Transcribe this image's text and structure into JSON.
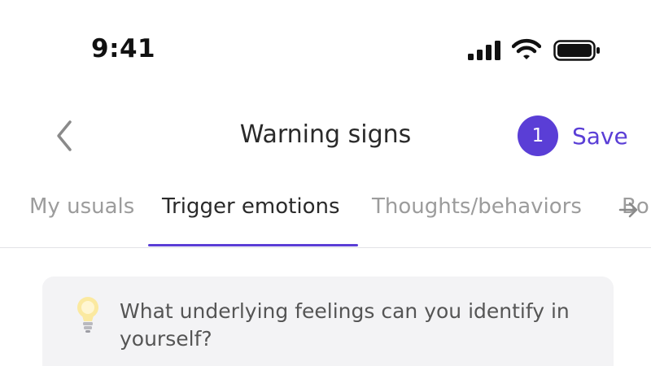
{
  "status_bar": {
    "time": "9:41",
    "icons": [
      "cellular-signal-icon",
      "wifi-icon",
      "battery-icon"
    ]
  },
  "header": {
    "back_icon": "chevron-left-icon",
    "title": "Warning signs",
    "count_badge": "1",
    "save_label": "Save"
  },
  "tabs": {
    "items": [
      {
        "label": "My usuals",
        "active": false
      },
      {
        "label": "Trigger emotions",
        "active": true
      },
      {
        "label": "Thoughts/behaviors",
        "active": false
      },
      {
        "label": "Bo",
        "active": false
      }
    ],
    "scroll_icon": "arrow-right-icon"
  },
  "prompt": {
    "icon": "lightbulb-icon",
    "text": "What underlying feelings can you identify in yourself?"
  },
  "colors": {
    "accent": "#5a3ed6",
    "text_primary": "#2a2a2a",
    "text_inactive": "#9c9c9c",
    "card_bg": "#f3f3f5"
  }
}
